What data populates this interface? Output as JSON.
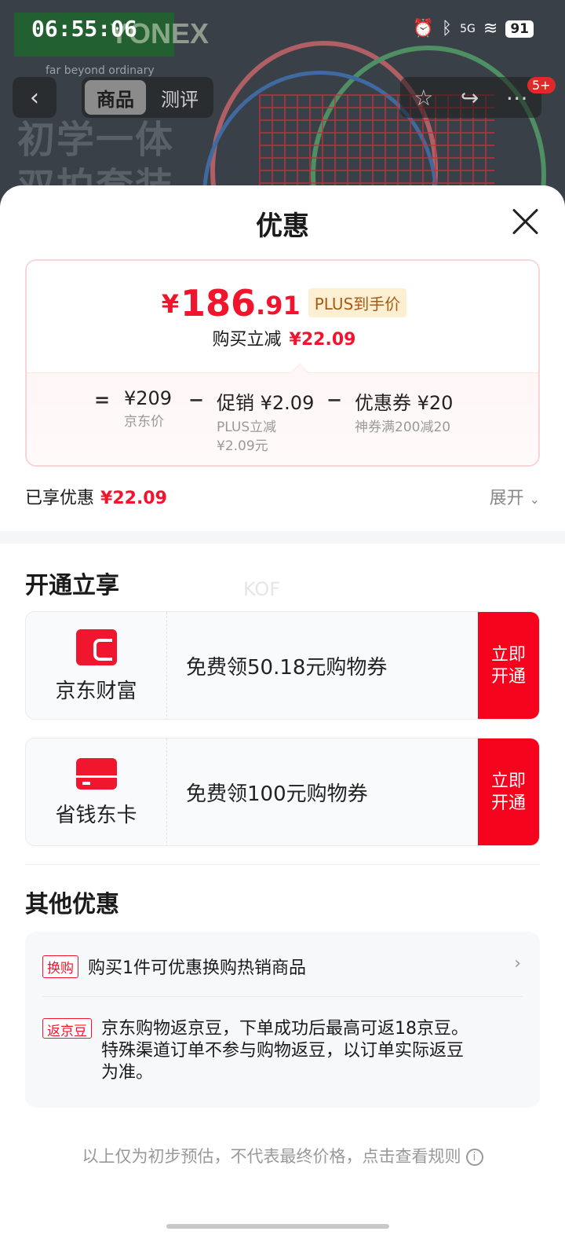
{
  "status_bar": {
    "time": "06:55:06",
    "battery": "91",
    "signal": "5G"
  },
  "background": {
    "brand": "YONEX",
    "tagline": "far beyond ordinary",
    "slogan_line1": "初学一体",
    "slogan_line2": "双拍套装"
  },
  "nav": {
    "tabs": [
      "商品",
      "测评"
    ],
    "active_tab": "商品",
    "badge": "5+"
  },
  "sheet": {
    "title": "优惠",
    "price": {
      "symbol": "¥",
      "integer": "186",
      "decimal": ".91",
      "plus_tag": "PLUS到手价"
    },
    "save": {
      "label": "购买立减",
      "amount": "¥22.09"
    },
    "breakdown": {
      "eq": "=",
      "minus": "−",
      "items": [
        {
          "main": "¥209",
          "sub": "京东价"
        },
        {
          "main": "促销 ¥2.09",
          "sub": "PLUS立减\n¥2.09元"
        },
        {
          "main": "优惠券 ¥20",
          "sub": "神券满200减20"
        }
      ]
    },
    "enjoyed": {
      "label": "已享优惠",
      "amount": "¥22.09",
      "expand": "展开"
    },
    "open_section": {
      "title": "开通立享",
      "watermark": "KOF",
      "promos": [
        {
          "name": "京东财富",
          "desc": "免费领50.18元购物券",
          "button": "立即开通"
        },
        {
          "name": "省钱东卡",
          "desc": "免费领100元购物券",
          "button": "立即开通"
        }
      ]
    },
    "other_section": {
      "title": "其他优惠",
      "items": [
        {
          "tag": "换购",
          "text": "购买1件可优惠换购热销商品"
        },
        {
          "tag": "返京豆",
          "text": "京东购物返京豆，下单成功后最高可返18京豆。特殊渠道订单不参与购物返豆，以订单实际返豆为准。"
        }
      ]
    },
    "footer_note": "以上仅为初步预估，不代表最终价格，点击查看规则"
  },
  "colors": {
    "accent": "#f2142c",
    "button": "#f5021c",
    "plus_bg": "#fdf0d2"
  }
}
